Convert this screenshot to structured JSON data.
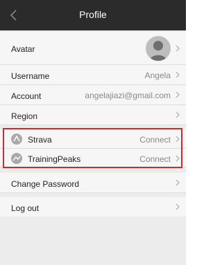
{
  "header": {
    "title": "Profile",
    "back_icon": "chevron-left-icon"
  },
  "rows": {
    "avatar": {
      "label": "Avatar"
    },
    "username": {
      "label": "Username",
      "value": "Angela"
    },
    "account": {
      "label": "Account",
      "value": "angelajiazi@gmail.com"
    },
    "region": {
      "label": "Region"
    },
    "strava": {
      "label": "Strava",
      "action": "Connect",
      "icon": "strava-icon"
    },
    "trainingpeaks": {
      "label": "TrainingPeaks",
      "action": "Connect",
      "icon": "trainingpeaks-icon"
    },
    "change_password": {
      "label": "Change Password"
    },
    "log_out": {
      "label": "Log out"
    }
  },
  "colors": {
    "navbar": "#2b2b2b",
    "highlight": "#d9252a",
    "background": "#ececec",
    "row": "#f6f6f6"
  }
}
